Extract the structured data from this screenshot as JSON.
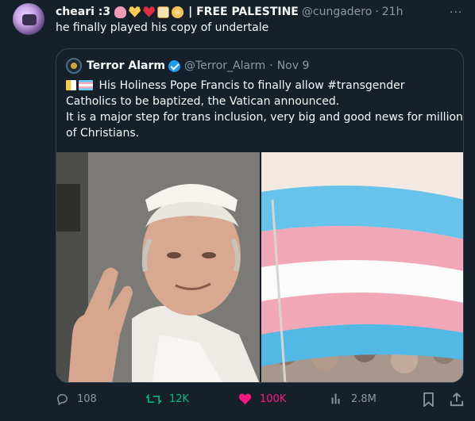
{
  "tweet": {
    "display_name": "cheari :3",
    "emoji_icons": [
      "octopus-icon",
      "yellow-heart-icon",
      "sparkling-heart-icon",
      "tarot-card-icon",
      "dvd-icon"
    ],
    "name_suffix": "| FREE PALESTINE",
    "handle": "@cungadero",
    "dot": "·",
    "time": "21h",
    "more_label": "···",
    "text": "he finally played his copy of undertale"
  },
  "quote": {
    "name": "Terror Alarm",
    "handle": "@Terror_Alarm",
    "dot": "·",
    "time": "Nov 9",
    "line1": "His Holiness Pope Francis to finally allow #transgender",
    "line2": "Catholics to be baptized, the Vatican announced.",
    "line3": "It is a major step for trans inclusion, very big and good news for millions",
    "line4": "of Christians.",
    "images": [
      {
        "name": "pope-photo",
        "alt": "Pope Francis waving"
      },
      {
        "name": "trans-flag-photo",
        "alt": "Transgender pride flag over a crowd"
      }
    ]
  },
  "actions": {
    "replies": "108",
    "retweets": "12K",
    "likes": "100K",
    "views": "2.8M"
  },
  "colors": {
    "background": "#15202b",
    "text": "#f7f9f9",
    "muted": "#8b98a5",
    "retweet_green": "#00ba7c",
    "like_pink": "#f91880",
    "verified_blue": "#1d9bf0",
    "border": "#38444d"
  }
}
